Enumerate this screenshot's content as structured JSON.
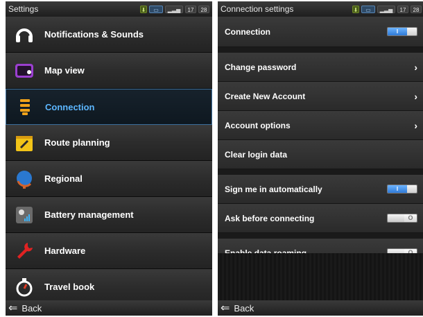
{
  "left": {
    "status": {
      "title": "Settings",
      "time_h": "17",
      "time_m": "28"
    },
    "items": [
      {
        "label": "Notifications & Sounds",
        "icon": "headphones-icon"
      },
      {
        "label": "Map view",
        "icon": "map-view-icon"
      },
      {
        "label": "Connection",
        "icon": "connection-icon",
        "selected": true
      },
      {
        "label": "Route planning",
        "icon": "route-planning-icon"
      },
      {
        "label": "Regional",
        "icon": "globe-icon"
      },
      {
        "label": "Battery management",
        "icon": "battery-icon"
      },
      {
        "label": "Hardware",
        "icon": "wrench-icon"
      },
      {
        "label": "Travel book",
        "icon": "stopwatch-icon"
      }
    ],
    "back": "Back"
  },
  "right": {
    "status": {
      "title": "Connection settings",
      "time_h": "17",
      "time_m": "28"
    },
    "connection": {
      "label": "Connection",
      "state": "on"
    },
    "rows": [
      {
        "label": "Change password",
        "chevron": true
      },
      {
        "label": "Create New Account",
        "chevron": true
      },
      {
        "label": "Account options",
        "chevron": true
      },
      {
        "label": "Clear login data",
        "chevron": false
      }
    ],
    "toggles": [
      {
        "label": "Sign me in automatically",
        "state": "on"
      },
      {
        "label": "Ask before connecting",
        "state": "off"
      }
    ],
    "roaming": {
      "label": "Enable data roaming",
      "state": "off"
    },
    "back": "Back"
  },
  "colors": {
    "accent": "#5cb6ff",
    "toggle_on": "#2f7ad6"
  }
}
